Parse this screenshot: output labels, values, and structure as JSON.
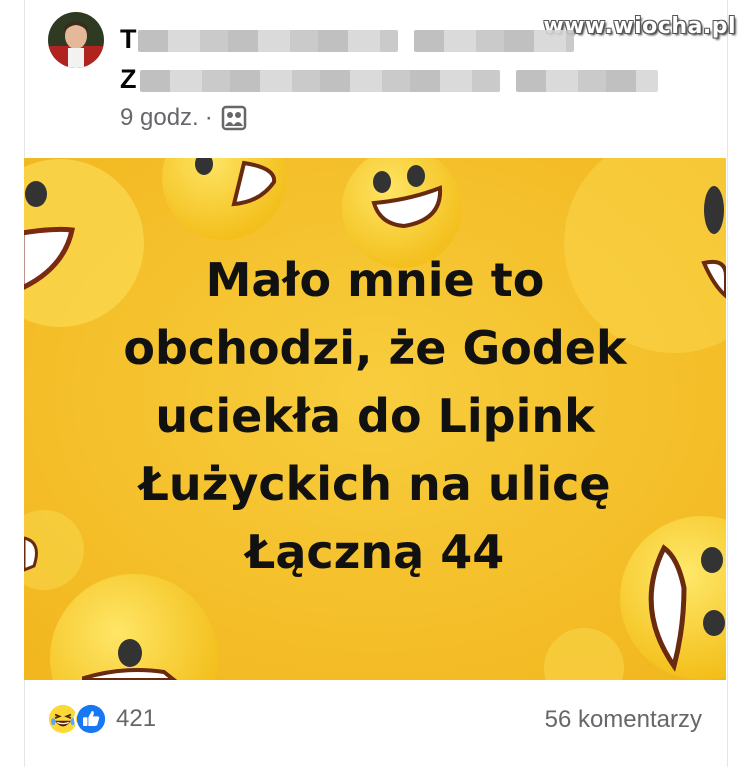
{
  "watermark": "www.wiocha.pl",
  "post": {
    "author_visible": "T",
    "group_visible": "Z",
    "time": "9 godz.",
    "separator": "·",
    "audience_icon": "group-audience-icon",
    "image_text": "Mało mnie to\nobchodzi, że Godek\nuciekła do Lipink\nŁużyckich na ulicę\nŁączną 44",
    "reaction_icons": [
      "laughing-emoji-icon",
      "like-thumb-icon"
    ],
    "reaction_count": "421",
    "comments": "56 komentarzy"
  },
  "colors": {
    "image_background": "#f6c331",
    "emoji_yellow": "#fcd936",
    "like_blue": "#1877f2",
    "meta_gray": "#65676b"
  }
}
